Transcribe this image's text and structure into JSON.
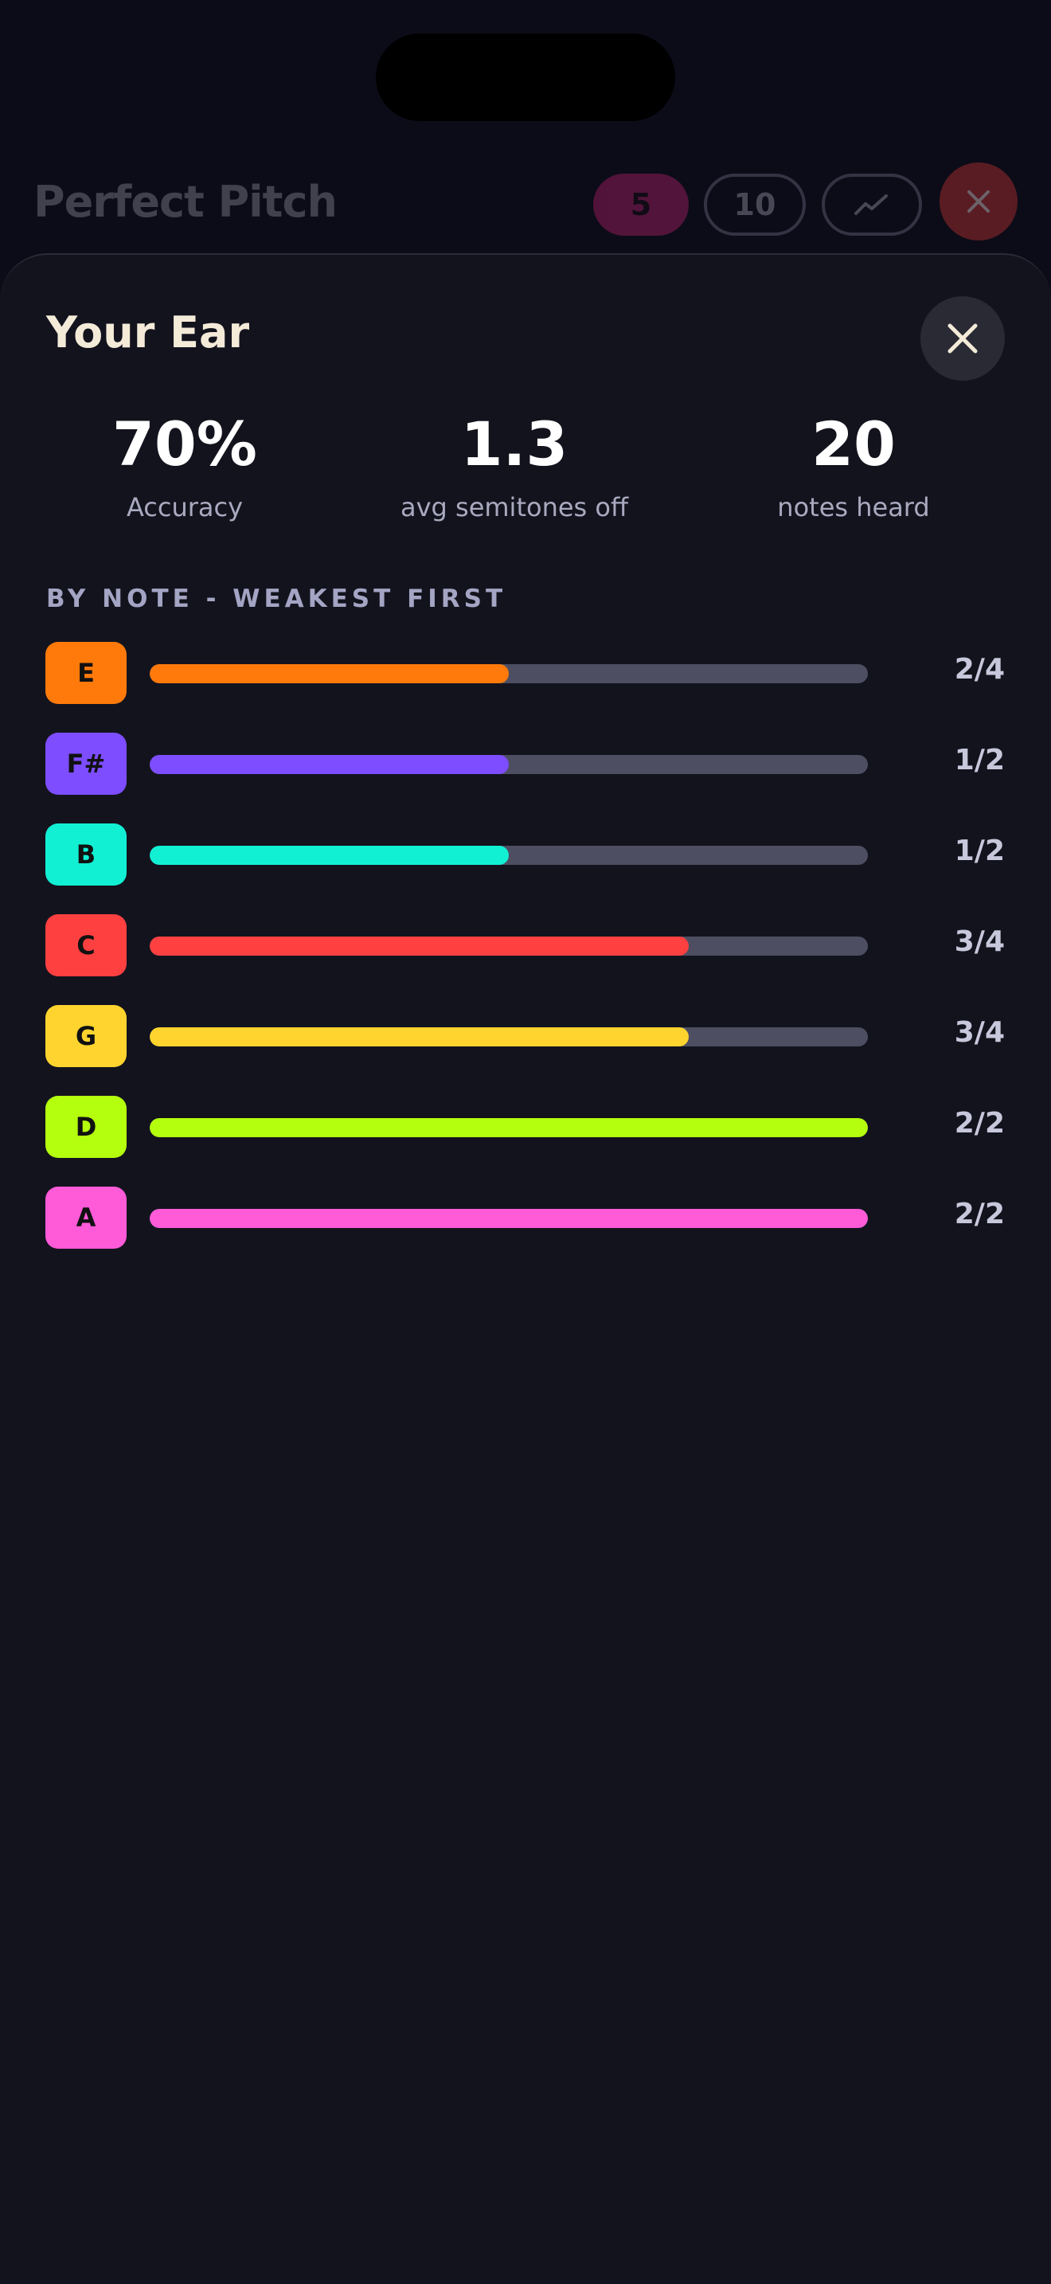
{
  "background": {
    "app_title": "Perfect Pitch",
    "chips": [
      {
        "label": "5",
        "active": true
      },
      {
        "label": "10",
        "active": false
      }
    ],
    "trend_icon": "trend-line-icon",
    "close_icon": "close-icon"
  },
  "sheet": {
    "title": "Your Ear",
    "close_icon": "close-icon",
    "stats": [
      {
        "value": "70%",
        "label": "Accuracy"
      },
      {
        "value": "1.3",
        "label": "avg semitones off"
      },
      {
        "value": "20",
        "label": "notes heard"
      }
    ],
    "section_header": "BY NOTE - WEAKEST FIRST",
    "notes": [
      {
        "note": "E",
        "correct": 2,
        "total": 4,
        "score": "2/4",
        "color": "#ff7a0a"
      },
      {
        "note": "F#",
        "correct": 1,
        "total": 2,
        "score": "1/2",
        "color": "#7d4dff"
      },
      {
        "note": "B",
        "correct": 1,
        "total": 2,
        "score": "1/2",
        "color": "#12f0d4"
      },
      {
        "note": "C",
        "correct": 3,
        "total": 4,
        "score": "3/4",
        "color": "#ff4040"
      },
      {
        "note": "G",
        "correct": 3,
        "total": 4,
        "score": "3/4",
        "color": "#ffd42e"
      },
      {
        "note": "D",
        "correct": 2,
        "total": 2,
        "score": "2/2",
        "color": "#b4ff0e"
      },
      {
        "note": "A",
        "correct": 2,
        "total": 2,
        "score": "2/2",
        "color": "#ff5ad8"
      }
    ]
  },
  "colors": {
    "accent_pink": "#b3206a",
    "close_red": "#c33232",
    "sheet_bg": "#13131e",
    "track": "#4e4e62"
  }
}
